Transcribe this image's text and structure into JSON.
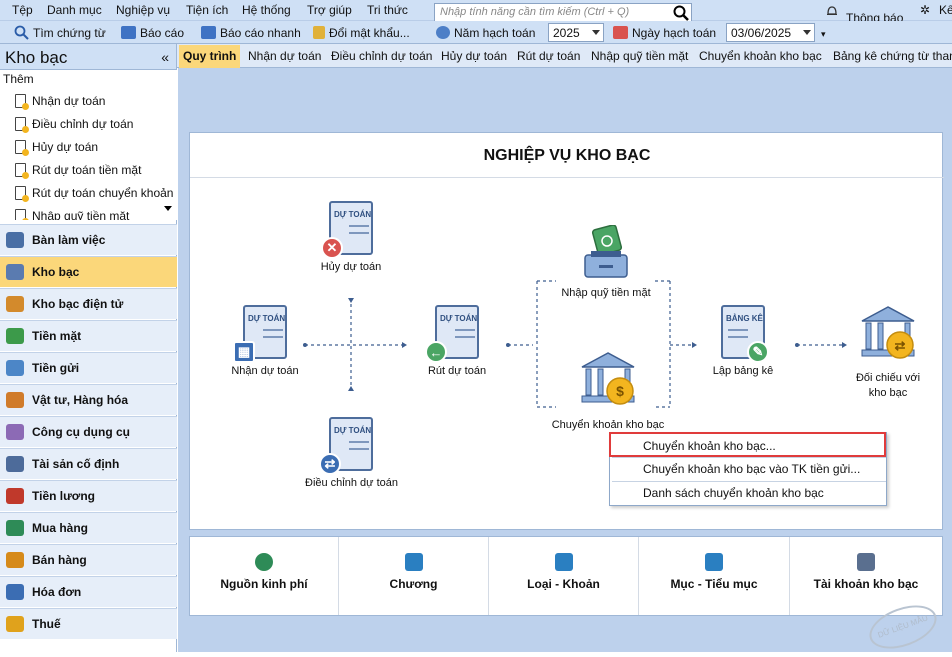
{
  "menu": [
    "Tệp",
    "Danh mục",
    "Nghiệp vụ",
    "Tiện ích",
    "Hệ thống",
    "Trợ giúp",
    "Tri thức"
  ],
  "search": {
    "placeholder": "Nhập tính năng cần tìm kiếm (Ctrl + Q)"
  },
  "notification": "Thông báo",
  "notification2": "Kế",
  "toolbar": {
    "find_voucher": "Tìm chứng từ",
    "report": "Báo cáo",
    "quick_report": "Báo cáo nhanh",
    "change_password": "Đổi mật khẩu...",
    "fiscal_year_label": "Năm hạch toán",
    "fiscal_year": "2025",
    "posting_date_label": "Ngày hạch toán",
    "posting_date": "03/06/2025"
  },
  "sidebar": {
    "title": "Kho bạc",
    "collapse": "«",
    "more": "Thêm",
    "subitems": [
      "Nhận dự toán",
      "Điều chỉnh dự toán",
      "Hủy dự toán",
      "Rút dự toán tiền mặt",
      "Rút dự toán chuyển khoản",
      "Nhập quỹ tiền mặt"
    ],
    "modules": [
      "Bàn làm việc",
      "Kho bạc",
      "Kho bạc điện tử",
      "Tiền mặt",
      "Tiền gửi",
      "Vật tư, Hàng hóa",
      "Công cụ dụng cụ",
      "Tài sản cố định",
      "Tiền lương",
      "Mua hàng",
      "Bán hàng",
      "Hóa đơn",
      "Thuế"
    ],
    "colors": {
      "active": "#fbd77a",
      "module_bg": "#e6eef9"
    }
  },
  "tabs": [
    "Quy trình",
    "Nhận dự toán",
    "Điều chỉnh dự toán",
    "Hủy dự toán",
    "Rút dự toán",
    "Nhập quỹ tiền mặt",
    "Chuyển khoản kho bạc",
    "Bảng kê chứng từ thanh"
  ],
  "process": {
    "title": "NGHIỆP VỤ KHO BẠC",
    "doc_header": "DỰ TOÁN",
    "doc_header_list": "BẢNG KÊ",
    "nodes": {
      "cancel": "Hủy dự toán",
      "receive": "Nhận dự toán",
      "adjust": "Điều chỉnh dự toán",
      "withdraw": "Rút dự toán",
      "deposit_cash": "Nhập quỹ tiền mặt",
      "transfer": "Chuyển khoản kho bạc",
      "list": "Lập bảng kê",
      "reconcile": "Đối chiếu với kho bạc"
    }
  },
  "context_menu": [
    "Chuyển khoản kho bạc...",
    "Chuyển khoản kho bạc vào TK tiền gửi...",
    "Danh sách chuyển khoản kho bạc"
  ],
  "bottom": [
    "Nguồn kinh phí",
    "Chương",
    "Loại - Khoản",
    "Mục - Tiểu mục",
    "Tài khoản kho bạc"
  ],
  "watermark": "DỮ LIỆU MẪU"
}
